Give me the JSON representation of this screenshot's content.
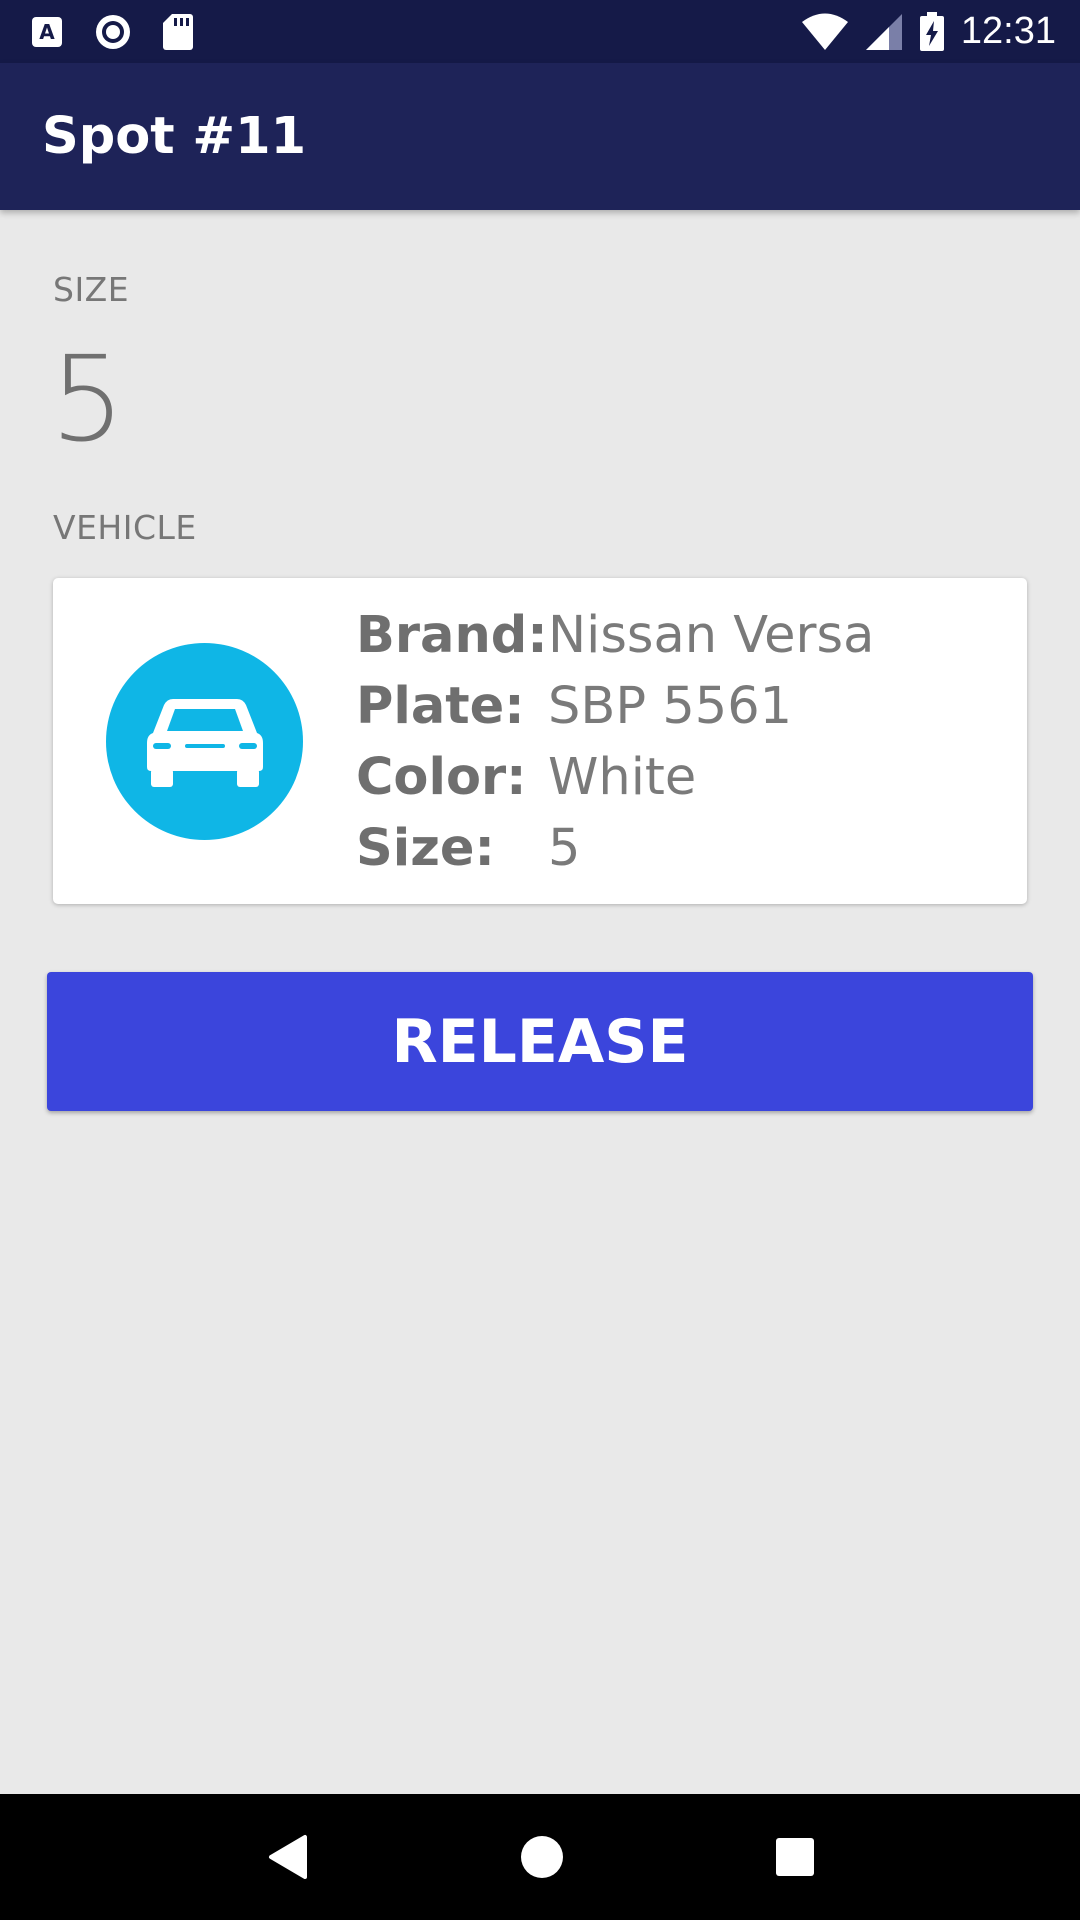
{
  "status_bar": {
    "time": "12:31",
    "left_icons": [
      "font-icon",
      "record-icon",
      "sd-card-icon"
    ],
    "right_icons": [
      "wifi-icon",
      "signal-icon",
      "battery-charging-icon"
    ]
  },
  "app_bar": {
    "title": "Spot #11"
  },
  "spot": {
    "size_label": "SIZE",
    "size_value": "5",
    "vehicle_label": "VEHICLE"
  },
  "vehicle": {
    "icon": "car-icon",
    "icon_bg_color": "#0fb6e6",
    "rows": [
      {
        "key": "Brand:",
        "value": "Nissan Versa"
      },
      {
        "key": "Plate:",
        "value": "SBP 5561"
      },
      {
        "key": "Color:",
        "value": "White"
      },
      {
        "key": "Size:",
        "value": "5"
      }
    ]
  },
  "actions": {
    "release_label": "RELEASE",
    "release_color": "#3b45dc"
  },
  "nav_bar": {
    "icons": [
      "back-icon",
      "home-icon",
      "recents-icon"
    ]
  }
}
